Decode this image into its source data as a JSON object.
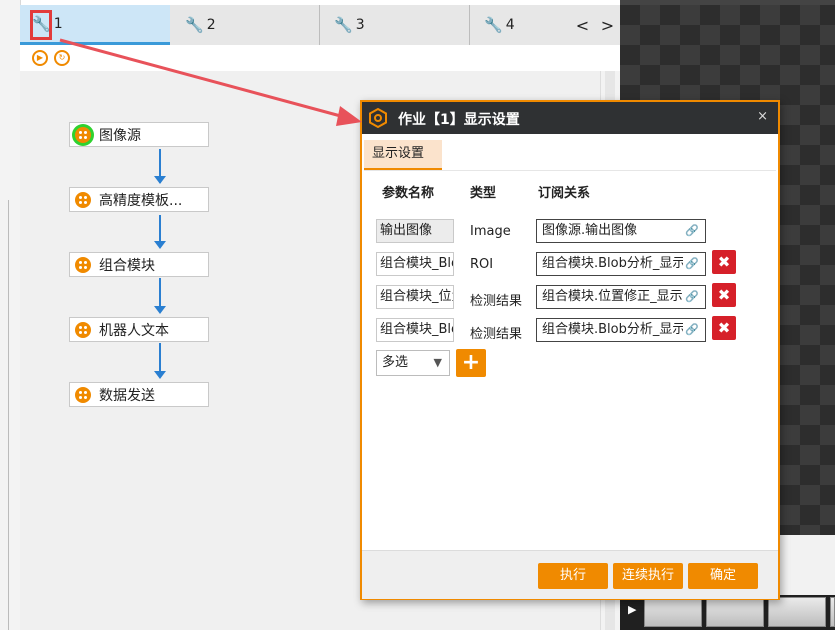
{
  "tabs": [
    {
      "label": "1",
      "icon": "wrench-icon"
    },
    {
      "label": "2",
      "icon": "wrench-icon"
    },
    {
      "label": "3",
      "icon": "wrench-icon"
    },
    {
      "label": "4",
      "icon": "wrench-icon"
    }
  ],
  "tab_nav": {
    "prev": "<",
    "next": ">"
  },
  "toolbar": {
    "run_icon": "play-circle-icon",
    "loop_icon": "loop-circle-icon"
  },
  "flow_nodes": [
    {
      "label": "图像源",
      "icon": "module-icon"
    },
    {
      "label": "高精度模板...",
      "icon": "module-icon"
    },
    {
      "label": "组合模块",
      "icon": "module-icon"
    },
    {
      "label": "机器人文本",
      "icon": "module-icon"
    },
    {
      "label": "数据发送",
      "icon": "module-icon"
    }
  ],
  "dialog": {
    "title": "作业【1】显示设置",
    "close": "×",
    "tab": "显示设置",
    "columns": {
      "param": "参数名称",
      "type": "类型",
      "subscription": "订阅关系"
    },
    "rows": [
      {
        "param": "输出图像",
        "type": "Image",
        "subscription": "图像源.输出图像",
        "deletable": false
      },
      {
        "param": "组合模块_Blob",
        "type": "ROI",
        "subscription": "组合模块.Blob分析_显示",
        "deletable": true
      },
      {
        "param": "组合模块_位置",
        "type": "检测结果",
        "subscription": "组合模块.位置修正_显示",
        "deletable": true
      },
      {
        "param": "组合模块_Blob",
        "type": "检测结果",
        "subscription": "组合模块.Blob分析_显示",
        "deletable": true
      }
    ],
    "link_glyph": "🔗",
    "delete_glyph": "✖",
    "multi_select": "多选",
    "add": "+",
    "buttons": {
      "run": "执行",
      "continuous_run": "连续执行",
      "confirm": "确定"
    }
  },
  "filmstrip": {
    "play": "▶"
  },
  "colors": {
    "accent": "#f08a00",
    "annotation": "#e23b3b",
    "flow_line": "#2a7fd1",
    "header": "#2f3133",
    "delete": "#d62029"
  }
}
